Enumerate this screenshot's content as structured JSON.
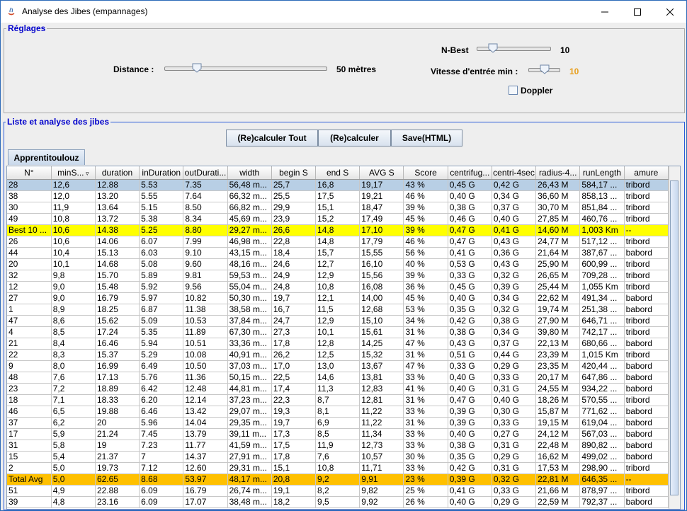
{
  "window": {
    "title": "Analyse des Jibes (empannages)"
  },
  "settings": {
    "legend": "Réglages",
    "distance": {
      "label": "Distance :",
      "value_text": "50 mètres",
      "fraction": 0.18
    },
    "nbest": {
      "label": "N-Best",
      "value_text": "10",
      "fraction": 0.18
    },
    "vmin": {
      "label": "Vitesse d'entrée min :",
      "value_text": "10",
      "fraction": 0.5,
      "color": "#e8a020"
    },
    "doppler": {
      "label": "Doppler",
      "checked": false
    }
  },
  "list": {
    "legend": "Liste et analyse des jibes",
    "buttons": {
      "recalc_all": "(Re)calculer Tout",
      "recalc": "(Re)calculer",
      "save": "Save(HTML)"
    },
    "tab": "Apprentitoulouz",
    "columns": [
      "N°",
      "minS...",
      "duration",
      "inDuration",
      "outDurati...",
      "width",
      "begin S",
      "end S",
      "AVG S",
      "Score",
      "centrifug...",
      "centri-4sec",
      "radius-4...",
      "runLength",
      "amure"
    ],
    "rows": [
      {
        "type": "sel",
        "c": [
          "28",
          "12,6",
          "12.88",
          "5.53",
          "7.35",
          "56,48 m...",
          "25,7",
          "16,8",
          "19,17",
          "43 %",
          "0,45 G",
          "0,42 G",
          "26,43 M",
          "584,17 ...",
          "tribord"
        ]
      },
      {
        "type": "",
        "c": [
          "38",
          "12,0",
          "13.20",
          "5.55",
          "7.64",
          "66,32 m...",
          "25,5",
          "17,5",
          "19,21",
          "46 %",
          "0,40 G",
          "0,34 G",
          "36,60 M",
          "858,13 ...",
          "tribord"
        ]
      },
      {
        "type": "",
        "c": [
          "30",
          "11,9",
          "13.64",
          "5.15",
          "8.50",
          "66,82 m...",
          "29,9",
          "15,1",
          "18,47",
          "39 %",
          "0,38 G",
          "0,37 G",
          "30,70 M",
          "851,84 ...",
          "tribord"
        ]
      },
      {
        "type": "",
        "c": [
          "49",
          "10,8",
          "13.72",
          "5.38",
          "8.34",
          "45,69 m...",
          "23,9",
          "15,2",
          "17,49",
          "45 %",
          "0,46 G",
          "0,40 G",
          "27,85 M",
          "460,76 ...",
          "tribord"
        ]
      },
      {
        "type": "best",
        "c": [
          "Best 10 ...",
          "10,6",
          "14.38",
          "5.25",
          "8.80",
          "29,27 m...",
          "26,6",
          "14,8",
          "17,10",
          "39 %",
          "0,47 G",
          "0,41 G",
          "14,60 M",
          "1,003 Km",
          "--"
        ]
      },
      {
        "type": "",
        "c": [
          "26",
          "10,6",
          "14.06",
          "6.07",
          "7.99",
          "46,98 m...",
          "22,8",
          "14,8",
          "17,79",
          "46 %",
          "0,47 G",
          "0,43 G",
          "24,77 M",
          "517,12 ...",
          "tribord"
        ]
      },
      {
        "type": "",
        "c": [
          "44",
          "10,4",
          "15.13",
          "6.03",
          "9.10",
          "43,15 m...",
          "18,4",
          "15,7",
          "15,55",
          "56 %",
          "0,41 G",
          "0,36 G",
          "21,64 M",
          "387,67 ...",
          "babord"
        ]
      },
      {
        "type": "",
        "c": [
          "20",
          "10,1",
          "14.68",
          "5.08",
          "9.60",
          "48,16 m...",
          "24,6",
          "12,7",
          "16,10",
          "40 %",
          "0,53 G",
          "0,43 G",
          "25,90 M",
          "600,99 ...",
          "tribord"
        ]
      },
      {
        "type": "",
        "c": [
          "32",
          "9,8",
          "15.70",
          "5.89",
          "9.81",
          "59,53 m...",
          "24,9",
          "12,9",
          "15,56",
          "39 %",
          "0,33 G",
          "0,32 G",
          "26,65 M",
          "709,28 ...",
          "tribord"
        ]
      },
      {
        "type": "",
        "c": [
          "12",
          "9,0",
          "15.48",
          "5.92",
          "9.56",
          "55,04 m...",
          "24,8",
          "10,8",
          "16,08",
          "36 %",
          "0,45 G",
          "0,39 G",
          "25,44 M",
          "1,055 Km",
          "tribord"
        ]
      },
      {
        "type": "",
        "c": [
          "27",
          "9,0",
          "16.79",
          "5.97",
          "10.82",
          "50,30 m...",
          "19,7",
          "12,1",
          "14,00",
          "45 %",
          "0,40 G",
          "0,34 G",
          "22,62 M",
          "491,34 ...",
          "babord"
        ]
      },
      {
        "type": "",
        "c": [
          "1",
          "8,9",
          "18.25",
          "6.87",
          "11.38",
          "38,58 m...",
          "16,7",
          "11,5",
          "12,68",
          "53 %",
          "0,35 G",
          "0,32 G",
          "19,74 M",
          "251,38 ...",
          "babord"
        ]
      },
      {
        "type": "",
        "c": [
          "47",
          "8,6",
          "15.62",
          "5.09",
          "10.53",
          "37,84 m...",
          "24,7",
          "12,9",
          "15,10",
          "34 %",
          "0,42 G",
          "0,38 G",
          "27,90 M",
          "646,71 ...",
          "tribord"
        ]
      },
      {
        "type": "",
        "c": [
          "4",
          "8,5",
          "17.24",
          "5.35",
          "11.89",
          "67,30 m...",
          "27,3",
          "10,1",
          "15,61",
          "31 %",
          "0,38 G",
          "0,34 G",
          "39,80 M",
          "742,17 ...",
          "tribord"
        ]
      },
      {
        "type": "",
        "c": [
          "21",
          "8,4",
          "16.46",
          "5.94",
          "10.51",
          "33,36 m...",
          "17,8",
          "12,8",
          "14,25",
          "47 %",
          "0,43 G",
          "0,37 G",
          "22,13 M",
          "680,66 ...",
          "babord"
        ]
      },
      {
        "type": "",
        "c": [
          "22",
          "8,3",
          "15.37",
          "5.29",
          "10.08",
          "40,91 m...",
          "26,2",
          "12,5",
          "15,32",
          "31 %",
          "0,51 G",
          "0,44 G",
          "23,39 M",
          "1,015 Km",
          "tribord"
        ]
      },
      {
        "type": "",
        "c": [
          "9",
          "8,0",
          "16.99",
          "6.49",
          "10.50",
          "37,03 m...",
          "17,0",
          "13,0",
          "13,67",
          "47 %",
          "0,33 G",
          "0,29 G",
          "23,35 M",
          "420,44 ...",
          "babord"
        ]
      },
      {
        "type": "",
        "c": [
          "48",
          "7,6",
          "17.13",
          "5.76",
          "11.36",
          "50,15 m...",
          "22,5",
          "14,6",
          "13,81",
          "33 %",
          "0,40 G",
          "0,33 G",
          "20,17 M",
          "647,86 ...",
          "babord"
        ]
      },
      {
        "type": "",
        "c": [
          "23",
          "7,2",
          "18.89",
          "6.42",
          "12.48",
          "44,81 m...",
          "17,4",
          "11,3",
          "12,83",
          "41 %",
          "0,40 G",
          "0,31 G",
          "24,55 M",
          "934,22 ...",
          "babord"
        ]
      },
      {
        "type": "",
        "c": [
          "18",
          "7,1",
          "18.33",
          "6.20",
          "12.14",
          "37,23 m...",
          "22,3",
          "8,7",
          "12,81",
          "31 %",
          "0,47 G",
          "0,40 G",
          "18,26 M",
          "570,55 ...",
          "tribord"
        ]
      },
      {
        "type": "",
        "c": [
          "46",
          "6,5",
          "19.88",
          "6.46",
          "13.42",
          "29,07 m...",
          "19,3",
          "8,1",
          "11,22",
          "33 %",
          "0,39 G",
          "0,30 G",
          "15,87 M",
          "771,62 ...",
          "babord"
        ]
      },
      {
        "type": "",
        "c": [
          "37",
          "6,2",
          "20",
          "5.96",
          "14.04",
          "29,35 m...",
          "19,7",
          "6,9",
          "11,22",
          "31 %",
          "0,39 G",
          "0,33 G",
          "19,15 M",
          "619,04 ...",
          "babord"
        ]
      },
      {
        "type": "",
        "c": [
          "17",
          "5,9",
          "21.24",
          "7.45",
          "13.79",
          "39,11 m...",
          "17,3",
          "8,5",
          "11,34",
          "33 %",
          "0,40 G",
          "0,27 G",
          "24,12 M",
          "567,03 ...",
          "babord"
        ]
      },
      {
        "type": "",
        "c": [
          "31",
          "5,8",
          "19",
          "7.23",
          "11.77",
          "41,59 m...",
          "17,5",
          "11,9",
          "12,73",
          "33 %",
          "0,38 G",
          "0,31 G",
          "22,48 M",
          "890,82 ...",
          "babord"
        ]
      },
      {
        "type": "",
        "c": [
          "15",
          "5,4",
          "21.37",
          "7",
          "14.37",
          "27,91 m...",
          "17,8",
          "7,6",
          "10,57",
          "30 %",
          "0,35 G",
          "0,29 G",
          "16,62 M",
          "499,02 ...",
          "babord"
        ]
      },
      {
        "type": "",
        "c": [
          "2",
          "5,0",
          "19.73",
          "7.12",
          "12.60",
          "29,31 m...",
          "15,1",
          "10,8",
          "11,71",
          "33 %",
          "0,42 G",
          "0,31 G",
          "17,53 M",
          "298,90 ...",
          "tribord"
        ]
      },
      {
        "type": "total",
        "c": [
          "Total Avg",
          "5,0",
          "62.65",
          "8.68",
          "53.97",
          "48,17 m...",
          "20,8",
          "9,2",
          "9,91",
          "23 %",
          "0,39 G",
          "0,32 G",
          "22,81 M",
          "646,35 ...",
          "--"
        ]
      },
      {
        "type": "",
        "c": [
          "51",
          "4,9",
          "22.88",
          "6.09",
          "16.79",
          "26,74 m...",
          "19,1",
          "8,2",
          "9,82",
          "25 %",
          "0,41 G",
          "0,33 G",
          "21,66 M",
          "878,97 ...",
          "tribord"
        ]
      },
      {
        "type": "",
        "c": [
          "39",
          "4,8",
          "23.16",
          "6.09",
          "17.07",
          "38,48 m...",
          "18,2",
          "9,5",
          "9,92",
          "26 %",
          "0,40 G",
          "0,29 G",
          "22,59 M",
          "792,37 ...",
          "babord"
        ]
      }
    ]
  }
}
